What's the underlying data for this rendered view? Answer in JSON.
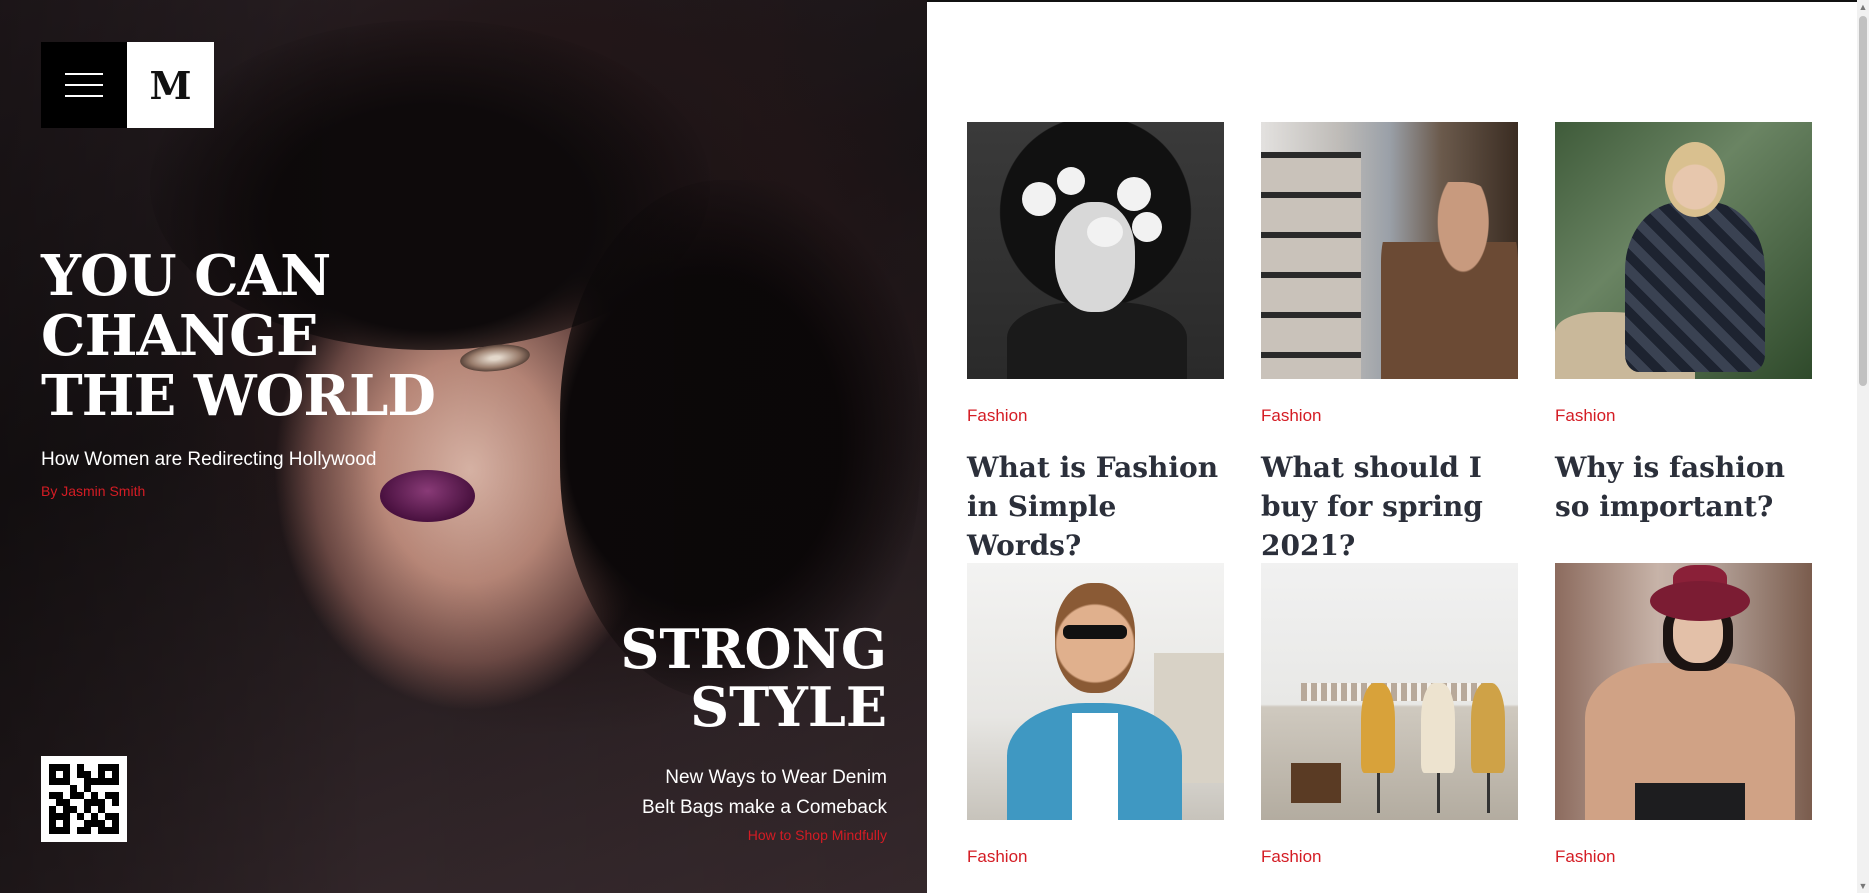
{
  "brand": {
    "logo_letter": "M"
  },
  "hero": {
    "title_lines": [
      "YOU CAN",
      "CHANGE",
      "THE WORLD"
    ],
    "subtitle": "How Women are Redirecting Hollywood",
    "byline": "By Jasmin Smith",
    "strong_lines": [
      "STRONG",
      "STYLE"
    ],
    "links": [
      "New Ways to Wear Denim",
      "Belt Bags make a Comeback"
    ],
    "red_link": "How to Shop Mindfully"
  },
  "articles": [
    {
      "category": "Fashion",
      "title": "What is Fashion in Simple Words?"
    },
    {
      "category": "Fashion",
      "title": "What should I buy for spring 2021?"
    },
    {
      "category": "Fashion",
      "title": "Why is fashion so important?"
    },
    {
      "category": "Fashion",
      "title": ""
    },
    {
      "category": "Fashion",
      "title": ""
    },
    {
      "category": "Fashion",
      "title": ""
    }
  ],
  "colors": {
    "accent": "#d41c24",
    "heading": "#2b2f3a"
  },
  "icons": {
    "menu": "hamburger-menu-icon",
    "qr": "qr-code-icon"
  }
}
